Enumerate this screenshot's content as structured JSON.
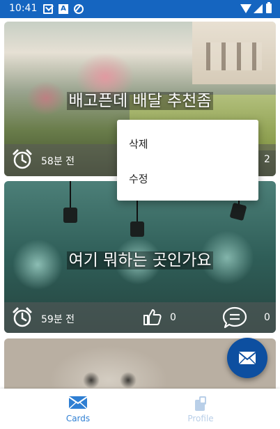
{
  "status_bar": {
    "time": "10:41",
    "icons": [
      "mail-icon",
      "a-icon",
      "sync-icon",
      "wifi-icon",
      "signal-icon",
      "battery-icon"
    ]
  },
  "cards": [
    {
      "caption": "배고픈데 배달 추천좀",
      "time": "58분 전",
      "comment_count": "2"
    },
    {
      "caption": "여기 뭐하는 곳인가요",
      "time": "59분 전",
      "like_count": "0",
      "comment_count": "0"
    },
    {
      "caption": ""
    }
  ],
  "context_menu": {
    "items": [
      {
        "label": "삭제"
      },
      {
        "label": "수정"
      }
    ]
  },
  "fab": {
    "icon": "mail-icon"
  },
  "bottom_nav": {
    "items": [
      {
        "label": "Cards",
        "icon": "mail-icon",
        "active": true
      },
      {
        "label": "Profile",
        "icon": "profile-icon",
        "active": false
      }
    ]
  },
  "colors": {
    "status_bar": "#1565c0",
    "fab": "#0d4fa0",
    "nav_active": "#2f7fd3",
    "nav_inactive": "#b9cfe8"
  }
}
